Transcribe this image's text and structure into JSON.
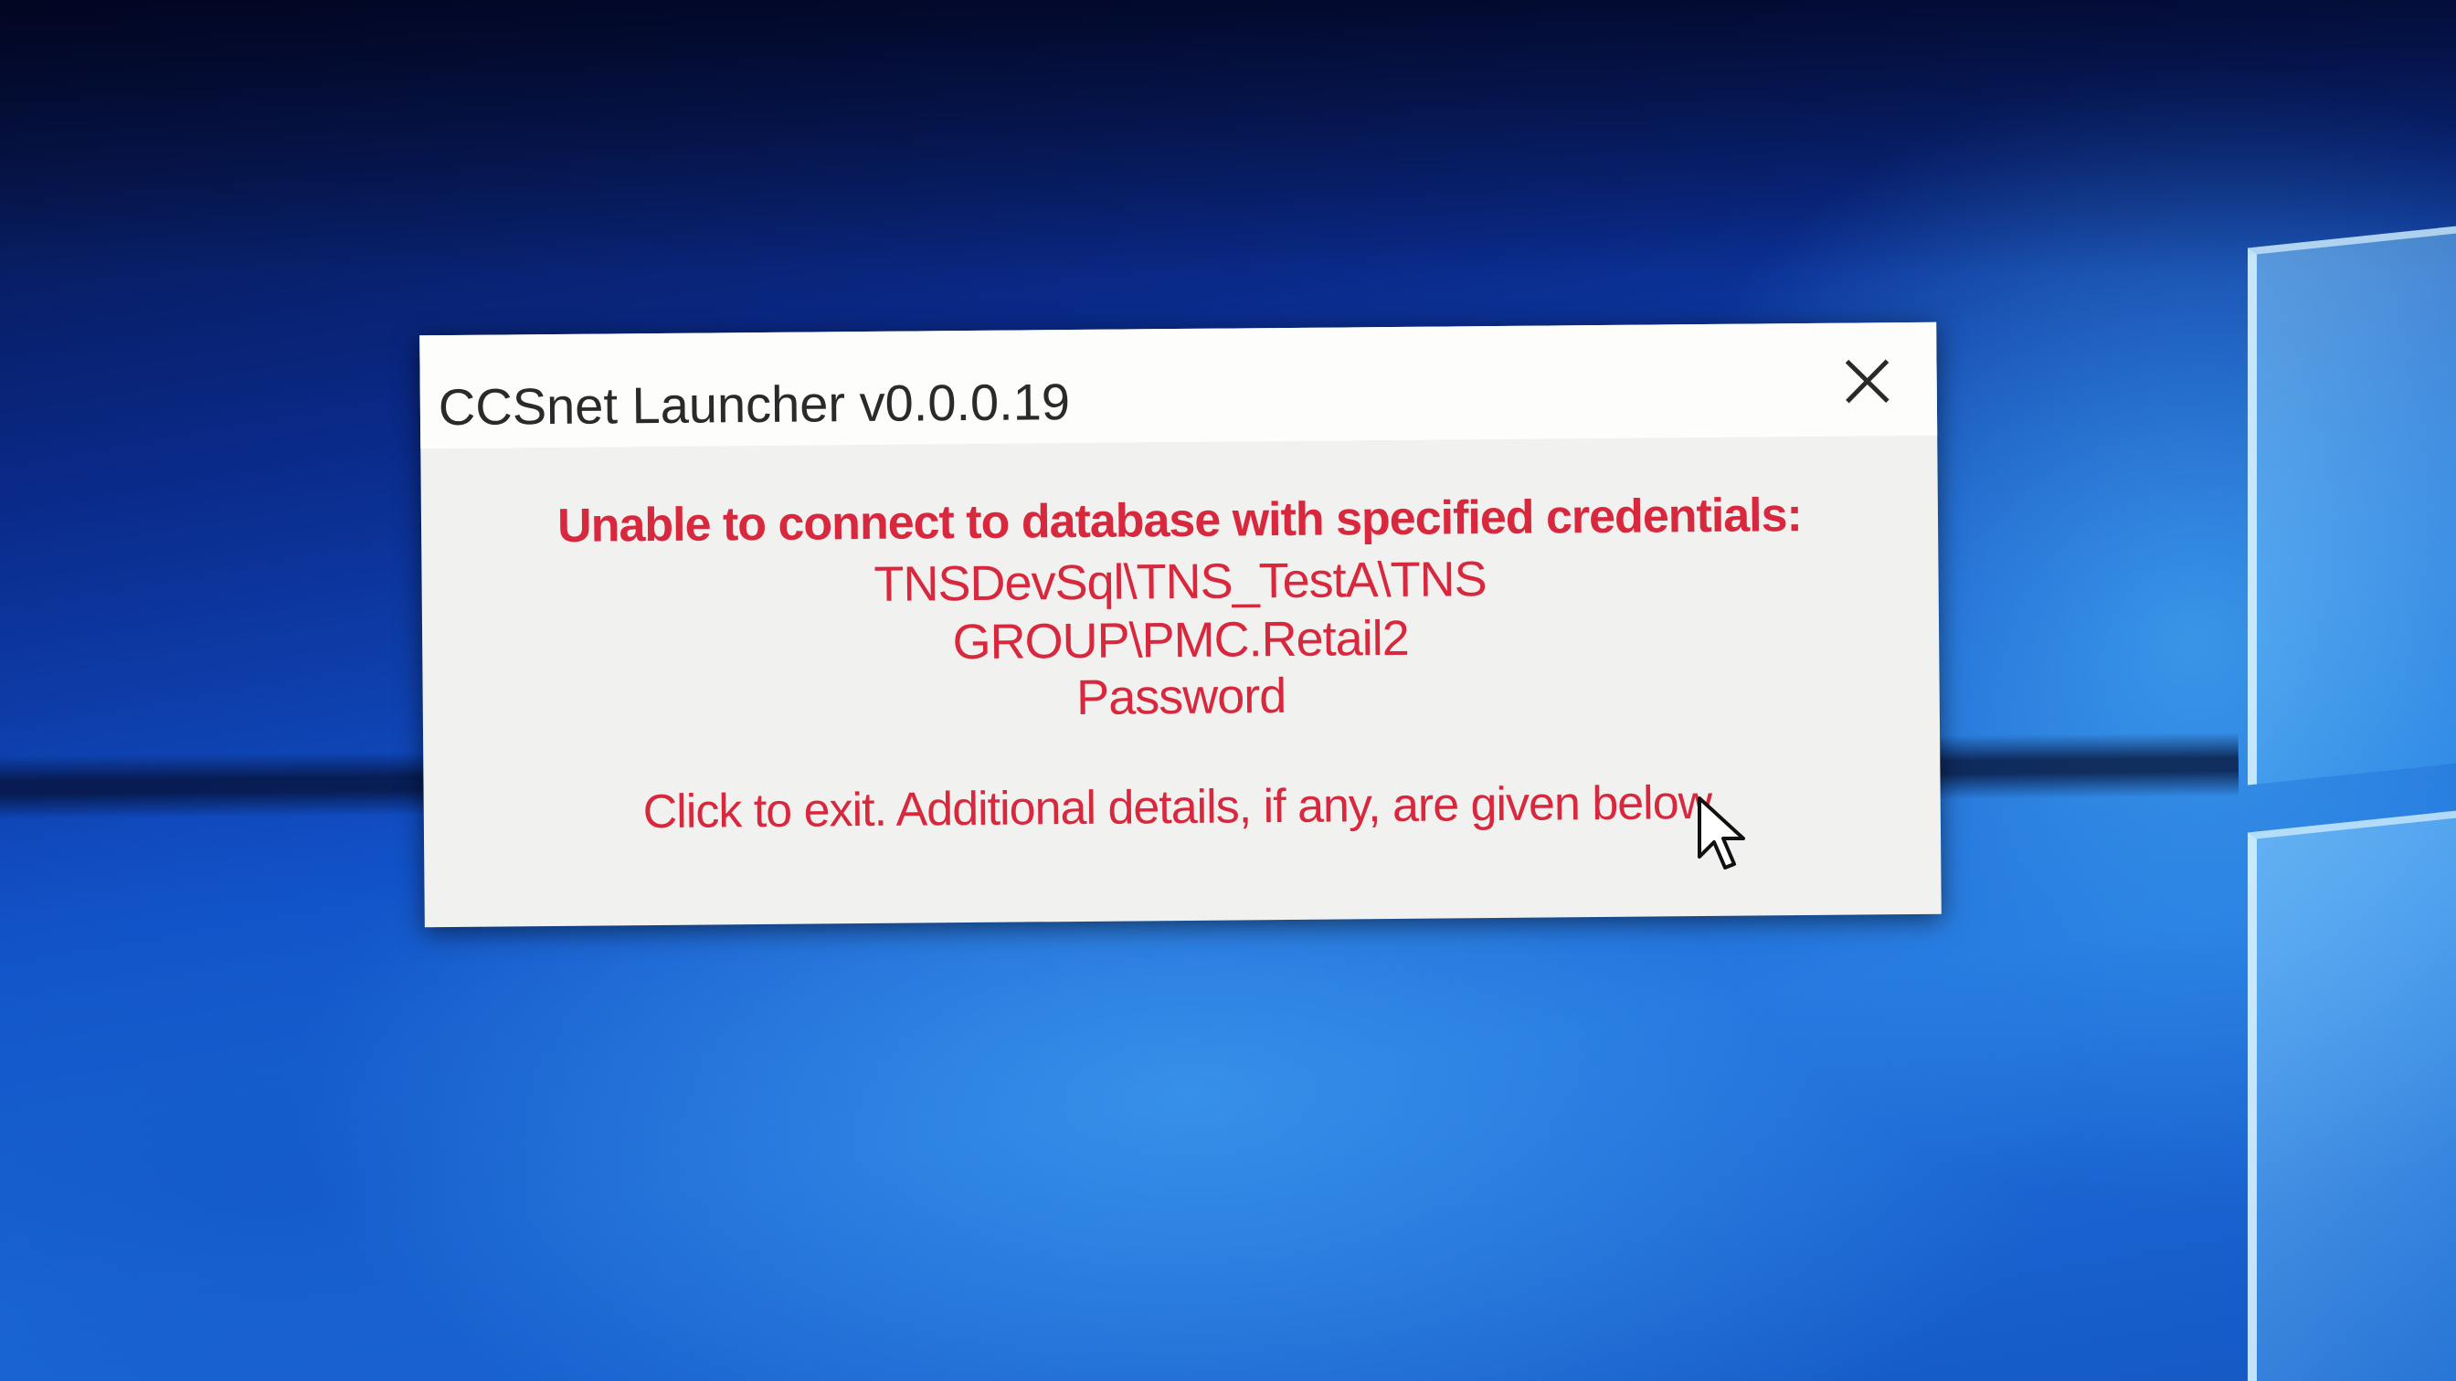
{
  "dialog": {
    "title": "CCSnet Launcher v0.0.0.19",
    "close_icon": "close-x-icon",
    "message": {
      "headline": "Unable to connect to database with specified credentials:",
      "line2": "TNSDevSql\\TNS_TestA\\TNS",
      "line3": "GROUP\\PMC.Retail2",
      "line4": "Password",
      "exit_text": "Click to exit. Additional details, if any, are given below."
    }
  },
  "pointer": "arrow-cursor-icon",
  "colors": {
    "error_text": "#d8283e",
    "dialog_bg": "#f1f1ef",
    "titlebar_bg": "#fdfdfb",
    "desktop_blue": "#1150c8"
  }
}
